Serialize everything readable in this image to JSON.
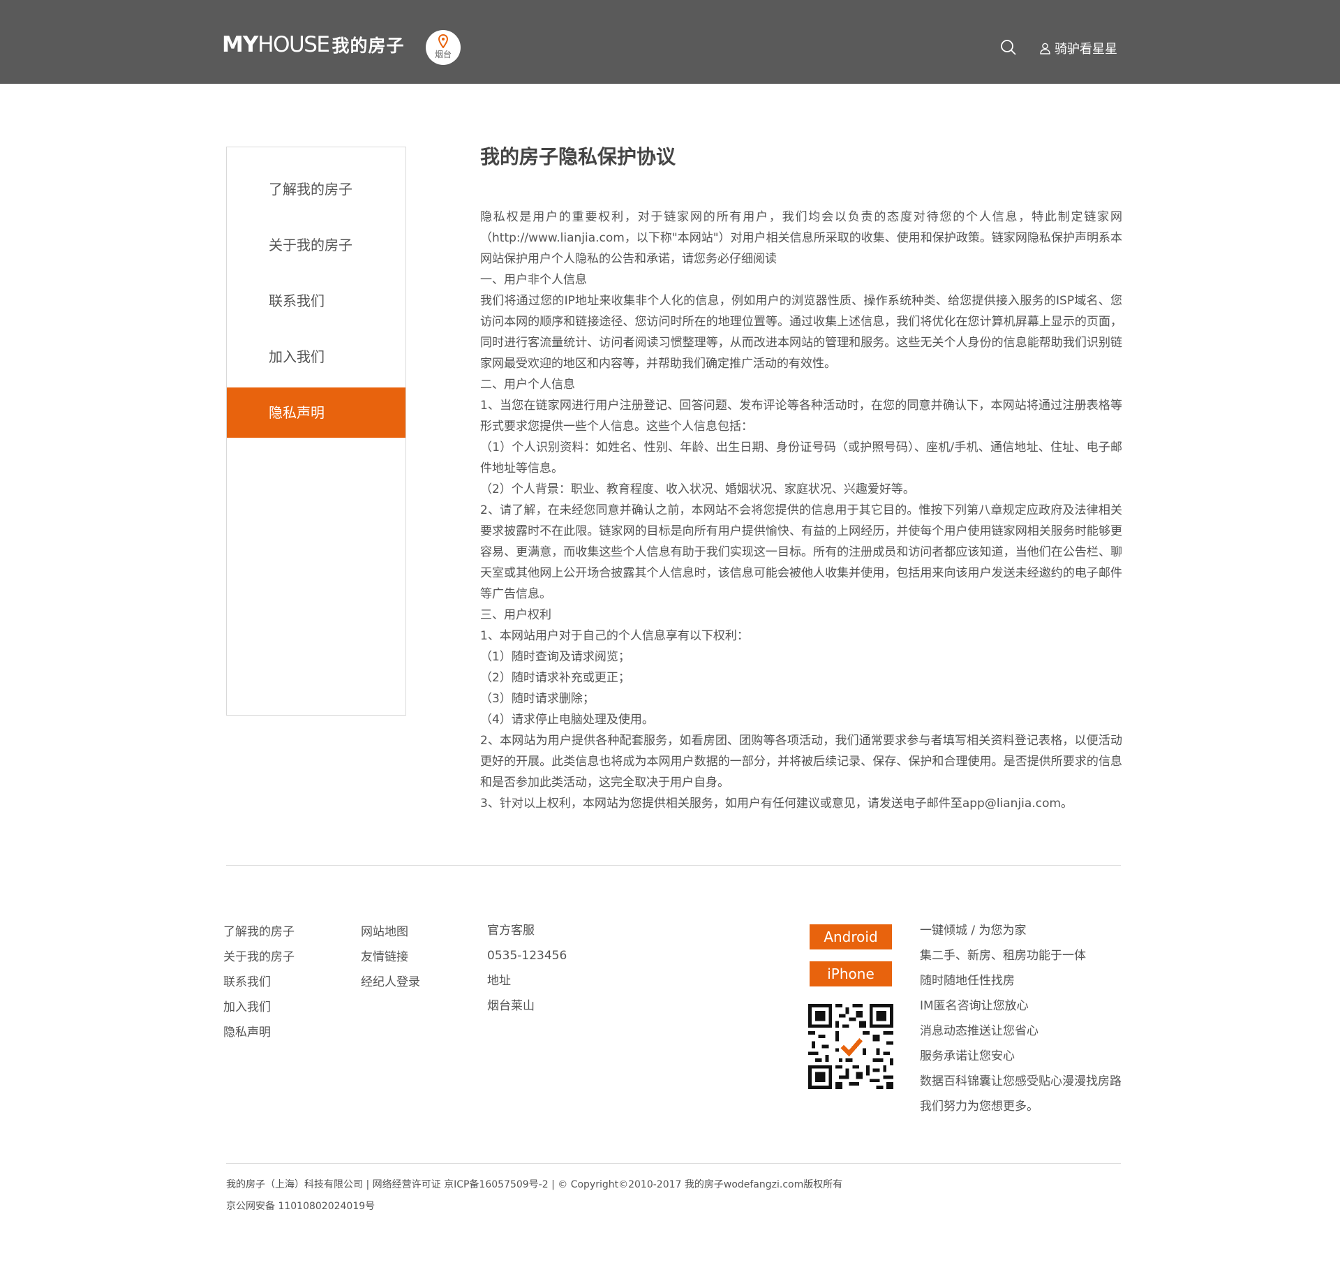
{
  "header": {
    "logo_my": "MY",
    "logo_house": "HOUSE",
    "logo_cn": "我的房子",
    "city": "烟台",
    "username": "骑驴看星星"
  },
  "sidebar": {
    "items": [
      {
        "label": "了解我的房子"
      },
      {
        "label": "关于我的房子"
      },
      {
        "label": "联系我们"
      },
      {
        "label": "加入我们"
      },
      {
        "label": "隐私声明"
      }
    ]
  },
  "article": {
    "title": "我的房子隐私保护协议",
    "paragraphs": [
      "隐私权是用户的重要权利，对于链家网的所有用户，我们均会以负责的态度对待您的个人信息，特此制定链家网（http://www.lianjia.com，以下称\"本网站\"）对用户相关信息所采取的收集、使用和保护政策。链家网隐私保护声明系本网站保护用户个人隐私的公告和承诺，请您务必仔细阅读",
      "一、用户非个人信息",
      "我们将通过您的IP地址来收集非个人化的信息，例如用户的浏览器性质、操作系统种类、给您提供接入服务的ISP域名、您访问本网的顺序和链接途径、您访问时所在的地理位置等。通过收集上述信息，我们将优化在您计算机屏幕上显示的页面，同时进行客流量统计、访问者阅读习惯整理等，从而改进本网站的管理和服务。这些无关个人身份的信息能帮助我们识别链家网最受欢迎的地区和内容等，并帮助我们确定推广活动的有效性。",
      "二、用户个人信息",
      "1、当您在链家网进行用户注册登记、回答问题、发布评论等各种活动时，在您的同意并确认下，本网站将通过注册表格等形式要求您提供一些个人信息。这些个人信息包括：",
      "（1）个人识别资料：如姓名、性别、年龄、出生日期、身份证号码（或护照号码）、座机/手机、通信地址、住址、电子邮件地址等信息。",
      "（2）个人背景：职业、教育程度、收入状况、婚姻状况、家庭状况、兴趣爱好等。",
      "2、请了解，在未经您同意并确认之前，本网站不会将您提供的信息用于其它目的。惟按下列第八章规定应政府及法律相关要求披露时不在此限。链家网的目标是向所有用户提供愉快、有益的上网经历，并使每个用户使用链家网相关服务时能够更容易、更满意，而收集这些个人信息有助于我们实现这一目标。所有的注册成员和访问者都应该知道，当他们在公告栏、聊天室或其他网上公开场合披露其个人信息时，该信息可能会被他人收集并使用，包括用来向该用户发送未经邀约的电子邮件等广告信息。",
      "三、用户权利",
      "1、本网站用户对于自己的个人信息享有以下权利：",
      "（1）随时查询及请求阅览；",
      "（2）随时请求补充或更正；",
      "（3）随时请求删除；",
      "（4）请求停止电脑处理及使用。",
      "2、本网站为用户提供各种配套服务，如看房团、团购等各项活动，我们通常要求参与者填写相关资料登记表格，以便活动更好的开展。此类信息也将成为本网用户数据的一部分，并将被后续记录、保存、保护和合理使用。是否提供所要求的信息和是否参加此类活动，这完全取决于用户自身。",
      "3、针对以上权利，本网站为您提供相关服务，如用户有任何建议或意见，请发送电子邮件至app@lianjia.com。"
    ]
  },
  "footer": {
    "col1": [
      "了解我的房子",
      "关于我的房子",
      "联系我们",
      "加入我们",
      "隐私声明"
    ],
    "col2": [
      "网站地图",
      "友情链接",
      "经纪人登录"
    ],
    "col3": [
      "官方客服",
      "0535-123456",
      "地址",
      "烟台莱山"
    ],
    "android": "Android",
    "iphone": "iPhone",
    "slogans": [
      "一键倾城 / 为您为家",
      "集二手、新房、租房功能于一体",
      "随时随地任性找房",
      "IM匿名咨询让您放心",
      "消息动态推送让您省心",
      "服务承诺让您安心",
      "数据百科锦囊让您感受贴心漫漫找房路",
      "我们努力为您想更多。"
    ],
    "copyright_line1": "我的房子（上海）科技有限公司 | 网络经营许可证 京ICP备16057509号-2 | © Copyright©2010-2017 我的房子wodefangzi.com版权所有",
    "copyright_line2": "京公网安备 11010802024019号"
  },
  "colors": {
    "header_bg": "#5a5a5a",
    "accent": "#e8630d"
  },
  "icons": [
    "location-pin-icon",
    "search-icon",
    "user-icon",
    "qr-code"
  ]
}
